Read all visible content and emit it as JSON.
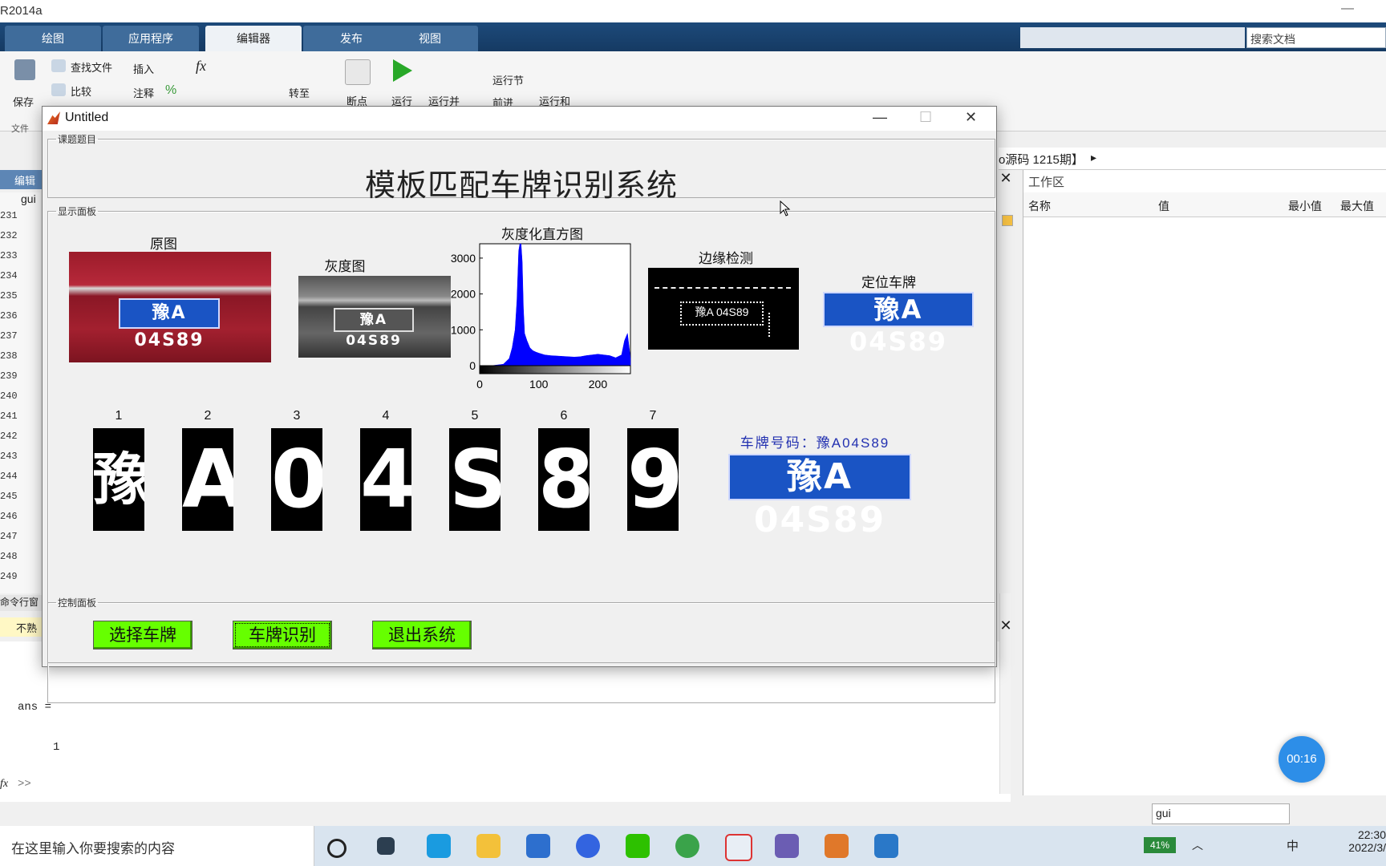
{
  "app": {
    "title": "R2014a"
  },
  "ribbon_tabs": [
    {
      "label": "绘图"
    },
    {
      "label": "应用程序"
    },
    {
      "label": "编辑器"
    },
    {
      "label": "发布"
    },
    {
      "label": "视图"
    }
  ],
  "ribbon": {
    "save": "保存",
    "find_files": "查找文件",
    "compare": "比较",
    "insert": "插入",
    "comment": "注释",
    "goto": "转至",
    "breakpoint": "断点",
    "run": "运行",
    "run_advance": "运行并",
    "run_section": "运行节",
    "advance": "前进",
    "run_time": "运行和",
    "file_group": "文件"
  },
  "search_docs": {
    "placeholder": "搜索文档"
  },
  "editor": {
    "tab": "编辑",
    "file": "gui",
    "line_numbers": [
      "231",
      "232",
      "233",
      "234",
      "235",
      "236",
      "237",
      "238",
      "239",
      "240",
      "241",
      "242",
      "243",
      "244",
      "245",
      "246",
      "247",
      "248",
      "249"
    ]
  },
  "command_window": {
    "label": "命令行窗",
    "info": "不熟",
    "ans_label": "ans =",
    "ans_value": "1",
    "prompt": ">>"
  },
  "current_folder": {
    "path": "o源码 1215期】"
  },
  "workspace": {
    "title": "工作区",
    "columns": {
      "name": "名称",
      "value": "值",
      "min": "最小值",
      "max": "最大值"
    },
    "filter_input": "gui"
  },
  "gui": {
    "window_title": "Untitled",
    "panels": {
      "title": "课题题目",
      "display": "显示面板",
      "control": "控制面板"
    },
    "system_title": "模板匹配车牌识别系统",
    "captions": {
      "original": "原图",
      "gray": "灰度图",
      "histogram": "灰度化直方图",
      "edge": "边缘检测",
      "locate": "定位车牌"
    },
    "plate_text": "豫A 04S89",
    "histogram_ticks": {
      "y": [
        "3000",
        "2000",
        "1000",
        "0"
      ],
      "x": [
        "0",
        "100",
        "200"
      ]
    },
    "chars": [
      {
        "num": "1",
        "glyph": "豫"
      },
      {
        "num": "2",
        "glyph": "A"
      },
      {
        "num": "3",
        "glyph": "0"
      },
      {
        "num": "4",
        "glyph": "4"
      },
      {
        "num": "5",
        "glyph": "S"
      },
      {
        "num": "6",
        "glyph": "8"
      },
      {
        "num": "7",
        "glyph": "9"
      }
    ],
    "result_label": "车牌号码：豫A04S89",
    "buttons": {
      "select": "选择车牌",
      "recognize": "车牌识别",
      "exit": "退出系统"
    }
  },
  "chart_data": {
    "type": "area",
    "title": "灰度化直方图",
    "xlabel": "",
    "ylabel": "",
    "xlim": [
      0,
      255
    ],
    "ylim": [
      0,
      3400
    ],
    "x": [
      0,
      20,
      40,
      50,
      55,
      60,
      63,
      66,
      68,
      70,
      72,
      74,
      76,
      80,
      85,
      90,
      95,
      100,
      110,
      120,
      130,
      140,
      150,
      160,
      170,
      180,
      190,
      200,
      210,
      220,
      230,
      240,
      245,
      250,
      255
    ],
    "y": [
      0,
      0,
      40,
      200,
      500,
      1000,
      1800,
      3200,
      3400,
      3400,
      2900,
      1600,
      900,
      700,
      500,
      420,
      380,
      350,
      300,
      280,
      270,
      260,
      250,
      240,
      250,
      280,
      300,
      320,
      300,
      280,
      220,
      300,
      700,
      900,
      200
    ],
    "color": "#0000ff"
  },
  "taskbar": {
    "search": "在这里输入你要搜索的内容",
    "battery": "41%",
    "time": "22:30",
    "date": "2022/3/",
    "timer": "00:16",
    "ime": "中"
  }
}
